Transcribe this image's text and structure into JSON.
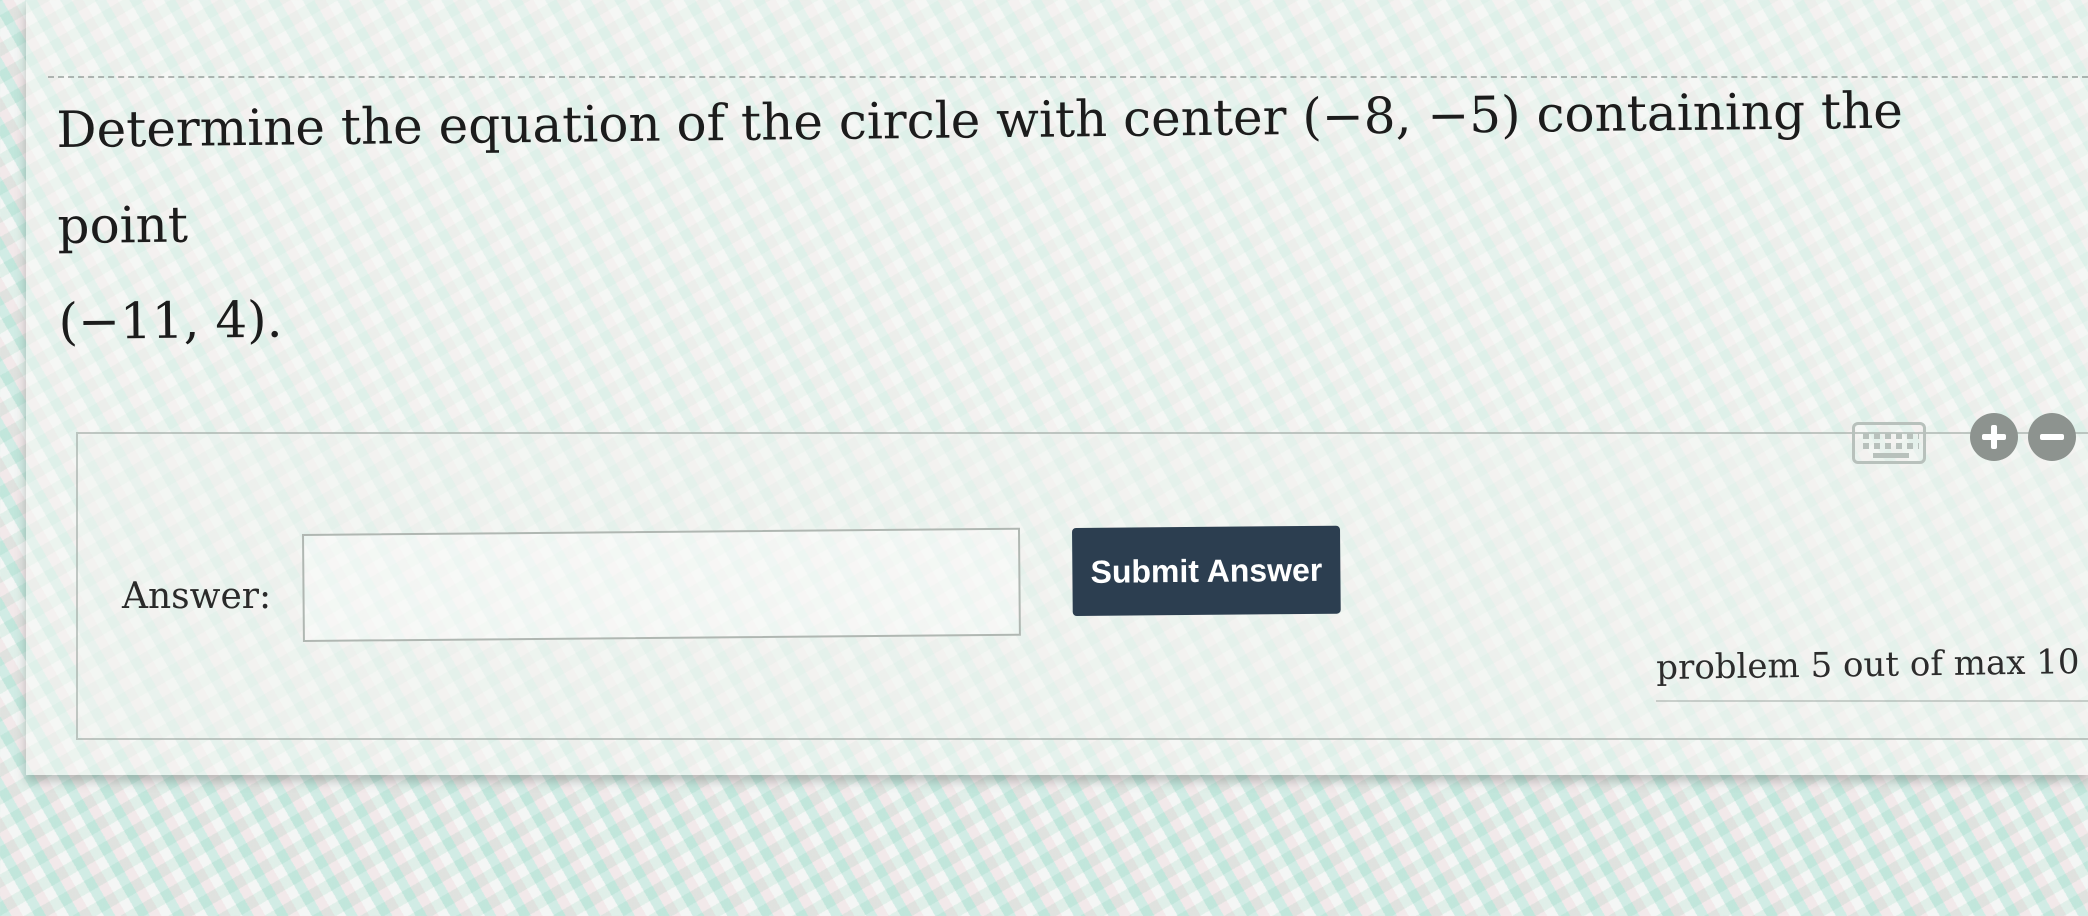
{
  "question": {
    "line1": "Determine the equation of the circle with center (−8, −5) containing the point",
    "line2": "(−11, 4)."
  },
  "toolbar": {
    "keyboard_icon": "keyboard-icon",
    "plus_icon": "plus-circle-icon",
    "minus_icon": "minus-circle-icon"
  },
  "answer": {
    "label": "Answer:",
    "value": "",
    "placeholder": ""
  },
  "submit": {
    "label": "Submit Answer"
  },
  "footer": {
    "problem_counter": "problem 5 out of max 10"
  },
  "colors": {
    "submit_background": "#2c3e50",
    "submit_text": "#ffffff",
    "icon_gray": "#8d938f",
    "keyboard_gray": "#b8c1bc",
    "text_dark": "#1c1c1c"
  }
}
